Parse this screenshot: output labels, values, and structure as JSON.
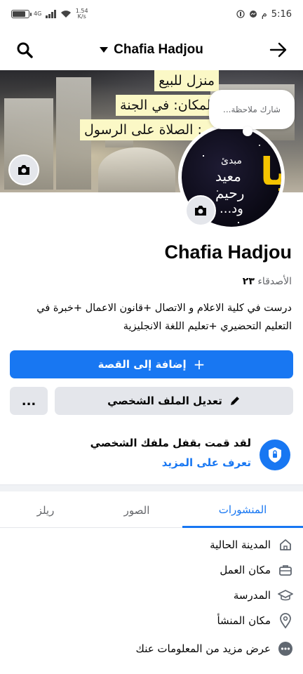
{
  "status_bar": {
    "time": "5:16",
    "time_suffix": "م",
    "network_label": "4G",
    "speed_value": "1.54",
    "speed_unit": "K/s",
    "battery_level": 0.85
  },
  "nav": {
    "profile_name": "Chafia Hadjou"
  },
  "cover": {
    "lines": [
      "منزل للبيع",
      "المكان: في الجنة",
      "...: الصلاة على الرسول"
    ]
  },
  "avatar": {
    "lines": [
      "مبدئ",
      "معيد",
      "رحيم",
      "ود..."
    ],
    "big_letter": "يا"
  },
  "note": {
    "placeholder": "شارك ملاحظة..."
  },
  "profile": {
    "name": "Chafia Hadjou",
    "friends_label": "الأصدقاء",
    "friends_count": "٢٣",
    "bio": "درست في كلية الاعلام و الاتصال +قانون الاعمال +خبرة في التعليم التحضيري +تعليم اللغة الانجليزية"
  },
  "buttons": {
    "add_story": "إضافة إلى القصة",
    "add_story_icon": "+",
    "edit_profile": "تعديل الملف الشخصي",
    "more": "..."
  },
  "lock": {
    "title": "لقد قمت بقفل ملفك الشخصي",
    "link": "تعرف على المزيد"
  },
  "tabs": [
    {
      "label": "المنشورات",
      "active": true
    },
    {
      "label": "الصور",
      "active": false
    },
    {
      "label": "ريلز",
      "active": false
    }
  ],
  "details": [
    {
      "icon": "home-icon",
      "label": "المدينة الحالية"
    },
    {
      "icon": "briefcase-icon",
      "label": "مكان العمل"
    },
    {
      "icon": "graduation-cap-icon",
      "label": "المدرسة"
    },
    {
      "icon": "location-pin-icon",
      "label": "مكان المنشأ"
    },
    {
      "icon": "more-dots-icon",
      "label": "عرض مزيد من المعلومات عنك"
    }
  ],
  "colors": {
    "accent": "#1877f2",
    "secondary_button": "#e4e6eb",
    "muted_text": "#65676b"
  }
}
